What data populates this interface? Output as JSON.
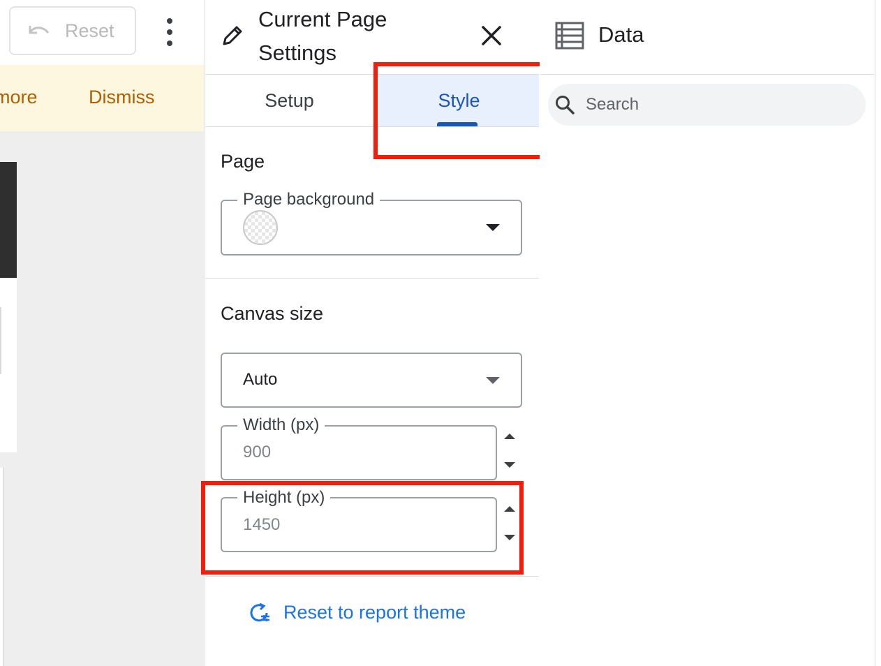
{
  "toolbar": {
    "reset_label": "Reset"
  },
  "banner": {
    "learn_more_label": "more",
    "dismiss_label": "Dismiss"
  },
  "panel": {
    "title_line1": "Current Page",
    "title_line2": "Settings",
    "tabs": [
      {
        "label": "Setup"
      },
      {
        "label": "Style"
      }
    ],
    "active_tab": "Style"
  },
  "page_section": {
    "heading": "Page",
    "background_label": "Page background"
  },
  "canvas_section": {
    "heading": "Canvas size",
    "size_value": "Auto",
    "width_label": "Width (px)",
    "width_value": "900",
    "height_label": "Height (px)",
    "height_value": "1450"
  },
  "reset_theme_label": "Reset to report theme",
  "data_panel": {
    "title": "Data",
    "search_placeholder": "Search"
  },
  "colors": {
    "highlight": "#f21e0a",
    "accent_blue": "#1a73e8",
    "tab_active_bg": "#e8f0fe",
    "banner_bg": "#fef7e0",
    "banner_text": "#b06000"
  }
}
